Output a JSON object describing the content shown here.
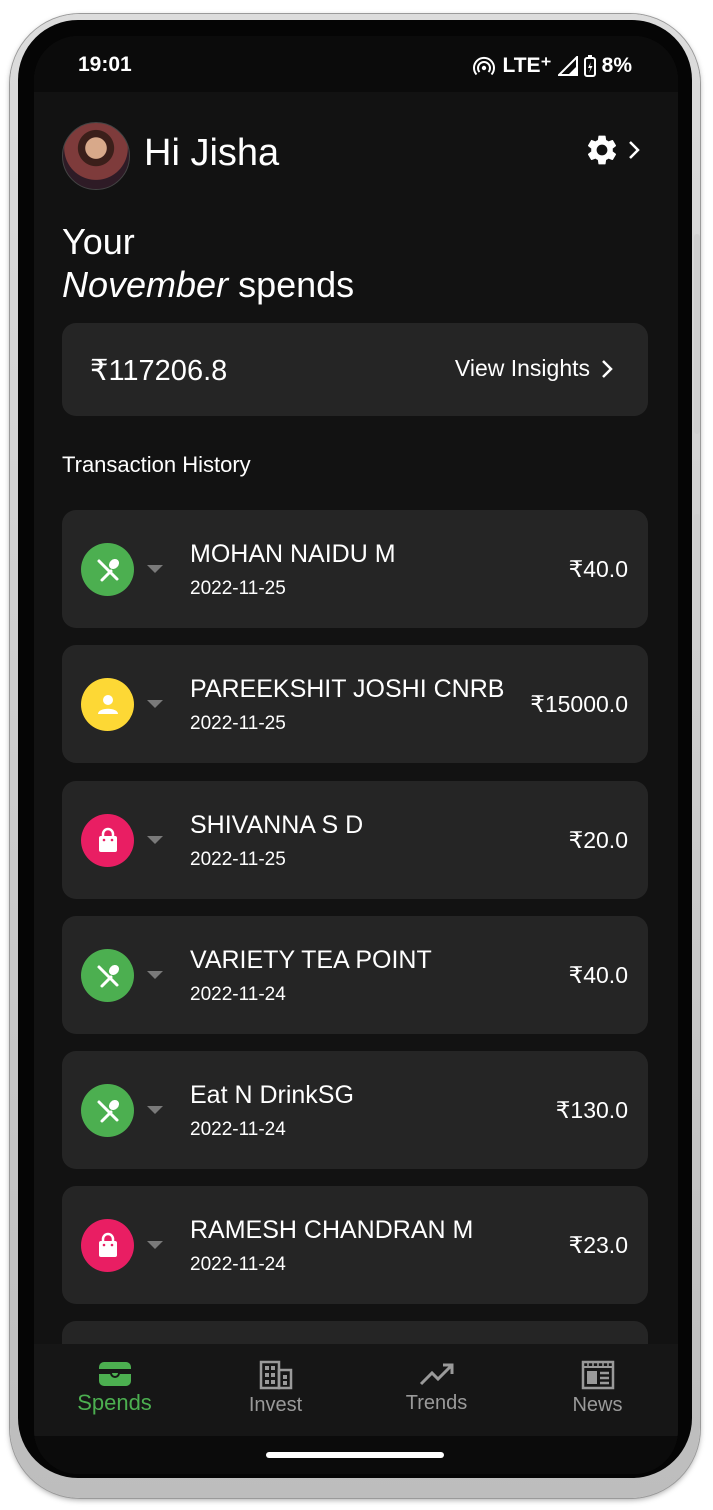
{
  "status_bar": {
    "time": "19:01",
    "network": "LTE⁺",
    "battery": "8%"
  },
  "header": {
    "greeting": "Hi Jisha",
    "avatar_icon": "profile-photo",
    "settings_icon": "gear-icon"
  },
  "spends": {
    "line1": "Your",
    "month": "November",
    "suffix": "spends"
  },
  "total": {
    "amount": "₹117206.8",
    "insights_label": "View Insights"
  },
  "section_label": "Transaction History",
  "transactions": [
    {
      "name": "MOHAN NAIDU  M",
      "date": "2022-11-25",
      "amount": "₹40.0",
      "category_icon": "food-icon",
      "color": "#4caf50"
    },
    {
      "name": "PAREEKSHIT JOSHI CNRB",
      "date": "2022-11-25",
      "amount": "₹15000.0",
      "category_icon": "person-icon",
      "color": "#fdd835"
    },
    {
      "name": "SHIVANNA S D",
      "date": "2022-11-25",
      "amount": "₹20.0",
      "category_icon": "shopping-bag-icon",
      "color": "#e91e63"
    },
    {
      "name": "VARIETY TEA POINT",
      "date": "2022-11-24",
      "amount": "₹40.0",
      "category_icon": "food-icon",
      "color": "#4caf50"
    },
    {
      "name": "Eat N DrinkSG",
      "date": "2022-11-24",
      "amount": "₹130.0",
      "category_icon": "food-icon",
      "color": "#4caf50"
    },
    {
      "name": "RAMESH CHANDRAN M",
      "date": "2022-11-24",
      "amount": "₹23.0",
      "category_icon": "shopping-bag-icon",
      "color": "#e91e63"
    }
  ],
  "nav": [
    {
      "label": "Spends",
      "icon": "wallet-icon",
      "active": true
    },
    {
      "label": "Invest",
      "icon": "building-icon",
      "active": false
    },
    {
      "label": "Trends",
      "icon": "trending-up-icon",
      "active": false
    },
    {
      "label": "News",
      "icon": "newspaper-icon",
      "active": false
    }
  ],
  "colors": {
    "background": "#121212",
    "card": "#252525",
    "accent": "#4caf50"
  }
}
